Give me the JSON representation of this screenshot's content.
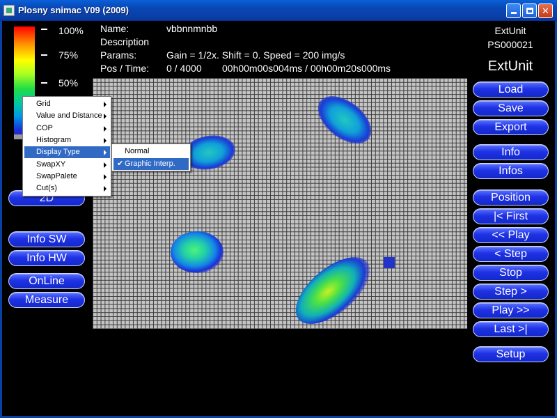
{
  "window": {
    "title": "Plosny snimac V09 (2009)"
  },
  "colorbar": {
    "labels": [
      "100%",
      "75%",
      "50%"
    ]
  },
  "info": {
    "name_label": "Name:",
    "name_value": "vbbnnmnbb",
    "description_label": "Description",
    "params_label": "Params:",
    "params_value": "Gain = 1/2x. Shift = 0. Speed = 200 img/s",
    "pos_label": "Pos / Time:",
    "pos_value": "0 / 4000",
    "time_value": "00h00m00s004ms / 00h00m20s000ms"
  },
  "unit": {
    "line1": "ExtUnit",
    "line2": "PS000021",
    "big": "ExtUnit"
  },
  "right_buttons": {
    "load": "Load",
    "save": "Save",
    "export": "Export",
    "info": "Info",
    "infos": "Infos",
    "position": "Position",
    "first": "|< First",
    "play_back": "<< Play",
    "step_back": "< Step",
    "stop": "Stop",
    "step_fwd": "Step >",
    "play_fwd": "Play >>",
    "last": "Last >|",
    "setup": "Setup"
  },
  "left_buttons": {
    "view_2d": "2D",
    "info_sw": "Info SW",
    "info_hw": "Info HW",
    "online": "OnLine",
    "measure": "Measure"
  },
  "context_menu": {
    "items": [
      "Grid",
      "Value and Distance",
      "COP",
      "Histogram",
      "Display Type",
      "SwapXY",
      "SwapPalete",
      "Cut(s)"
    ],
    "active_index": 4
  },
  "submenu": {
    "items": [
      "Normal",
      "Graphic Interp."
    ],
    "checked_index": 1
  },
  "colors": {
    "button_face": "#1f32e6",
    "menu_highlight": "#316ac5",
    "grid_bg": "#c4c4c4"
  }
}
